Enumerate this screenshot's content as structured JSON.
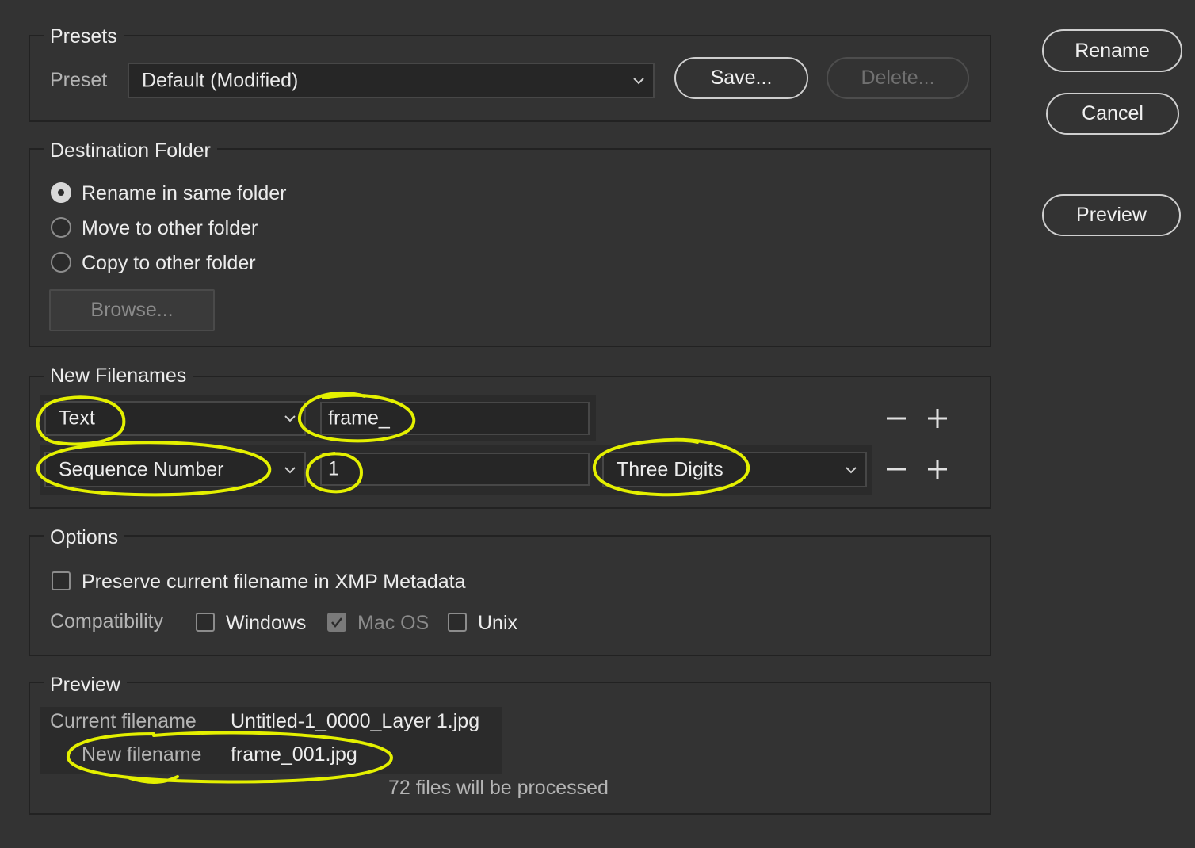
{
  "presets": {
    "group_title": "Presets",
    "preset_label": "Preset",
    "preset_value": "Default (Modified)",
    "save_label": "Save...",
    "delete_label": "Delete..."
  },
  "actions": {
    "rename_label": "Rename",
    "cancel_label": "Cancel",
    "preview_label": "Preview"
  },
  "destination": {
    "group_title": "Destination Folder",
    "options": [
      {
        "label": "Rename in same folder",
        "selected": true
      },
      {
        "label": "Move to other folder",
        "selected": false
      },
      {
        "label": "Copy to other folder",
        "selected": false
      }
    ],
    "browse_label": "Browse..."
  },
  "new_filenames": {
    "group_title": "New Filenames",
    "rows": [
      {
        "type": "Text",
        "value": "frame_",
        "format": ""
      },
      {
        "type": "Sequence Number",
        "value": "1",
        "format": "Three Digits"
      }
    ]
  },
  "options": {
    "group_title": "Options",
    "preserve_label": "Preserve current filename in XMP Metadata",
    "preserve_checked": false,
    "compat_label": "Compatibility",
    "windows_label": "Windows",
    "windows_checked": false,
    "macos_label": "Mac OS",
    "macos_checked": true,
    "unix_label": "Unix",
    "unix_checked": false
  },
  "preview": {
    "group_title": "Preview",
    "current_label": "Current filename",
    "current_value": "Untitled-1_0000_Layer 1.jpg",
    "new_label": "New filename",
    "new_value": "frame_001.jpg",
    "files_note": "72 files will be processed"
  },
  "colors": {
    "background": "#333333",
    "annotation": "#e4f000"
  }
}
